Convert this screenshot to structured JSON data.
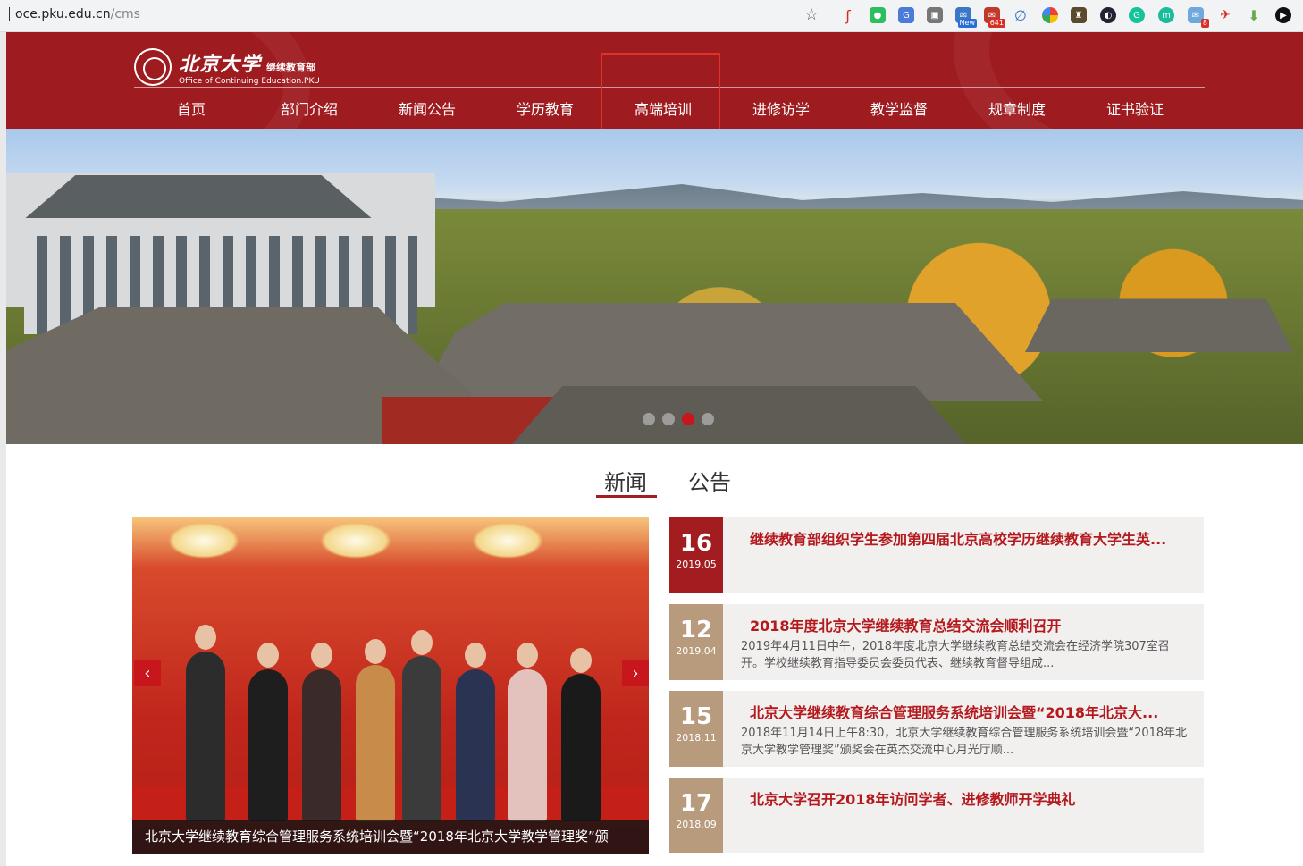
{
  "browser": {
    "url_host": "oce.pku.edu.cn",
    "url_path": "/cms",
    "ext_badges": {
      "new": "New",
      "mail": "641",
      "msg": "8"
    }
  },
  "header": {
    "logo_cn": "北京大学",
    "logo_dept": "继续教育部",
    "logo_en": "Office of Continuing Education.PKU",
    "nav": [
      "首页",
      "部门介绍",
      "新闻公告",
      "学历教育",
      "高端培训",
      "进修访学",
      "教学监督",
      "规章制度",
      "证书验证"
    ]
  },
  "tabs": {
    "news": "新闻",
    "notice": "公告"
  },
  "feature": {
    "caption": "北京大学继续教育综合管理服务系统培训会暨“2018年北京大学教学管理奖”颁",
    "prev": "‹",
    "next": "›"
  },
  "news": [
    {
      "day": "16",
      "ym": "2019.05",
      "title": "继续教育部组织学生参加第四届北京高校学历继续教育大学生英...",
      "summary": "",
      "color": "#a31c20"
    },
    {
      "day": "12",
      "ym": "2019.04",
      "title": "2018年度北京大学继续教育总结交流会顺利召开",
      "summary": "2019年4月11日中午，2018年度北京大学继续教育总结交流会在经济学院307室召开。学校继续教育指导委员会委员代表、继续教育督导组成...",
      "color": "#b89a7c"
    },
    {
      "day": "15",
      "ym": "2018.11",
      "title": "北京大学继续教育综合管理服务系统培训会暨“2018年北京大...",
      "summary": "2018年11月14日上午8:30，北京大学继续教育综合管理服务系统培训会暨“2018年北京大学教学管理奖”颁奖会在英杰交流中心月光厅顺...",
      "color": "#b89a7c"
    },
    {
      "day": "17",
      "ym": "2018.09",
      "title": "北京大学召开2018年访问学者、进修教师开学典礼",
      "summary": "",
      "color": "#b89a7c"
    }
  ],
  "colors": {
    "brand": "#9e1b1f",
    "accent": "#c8161d",
    "date_active": "#a31c20",
    "date_inactive": "#b89a7c"
  }
}
